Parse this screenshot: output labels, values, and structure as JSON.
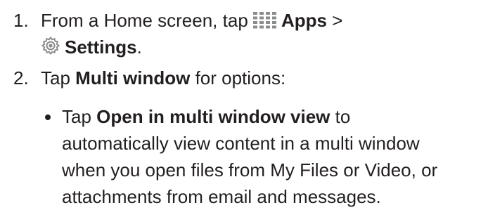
{
  "steps": [
    {
      "number": "1.",
      "line1_before": "From a Home screen, tap ",
      "apps_icon": "apps-grid-icon",
      "apps_label": "Apps",
      "line1_after": " >",
      "settings_icon": "settings-gear-icon",
      "settings_label": "Settings",
      "line2_after": "."
    },
    {
      "number": "2.",
      "before": "Tap ",
      "bold": "Multi window",
      "after": " for options:"
    }
  ],
  "bullets": [
    {
      "before": "Tap ",
      "bold": "Open in multi window view",
      "line1_after": " to",
      "line2": "automatically view content in a multi window",
      "line3": "when you open files from My Files or Video, or",
      "line4": "attachments from email and messages."
    }
  ],
  "colors": {
    "text": "#231f20",
    "icon": "#8a8c8e"
  }
}
